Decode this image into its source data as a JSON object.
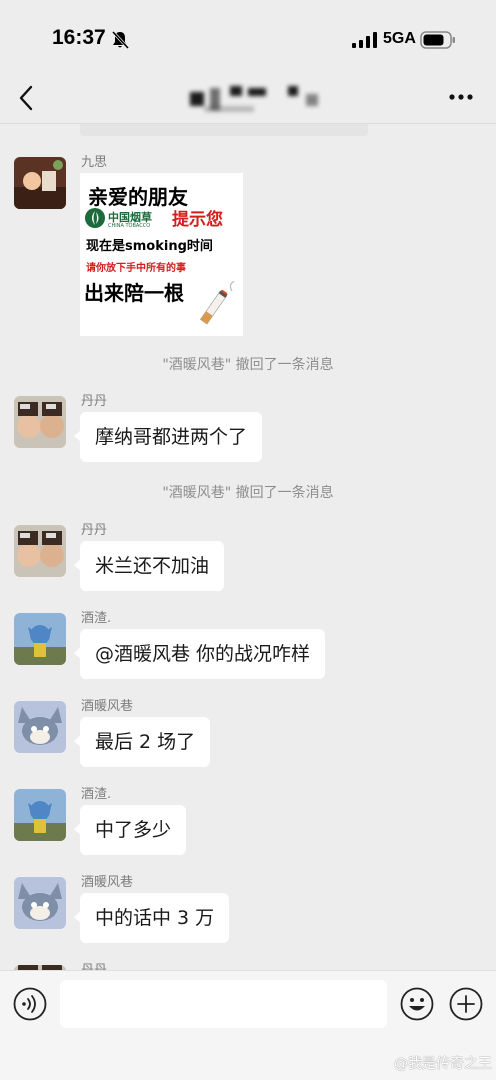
{
  "status_bar": {
    "time": "16:37",
    "network": "5GA"
  },
  "nav": {
    "back_icon": "chevron-left-icon",
    "more_icon": "more-dots-icon"
  },
  "messages": [
    {
      "sender": "九思",
      "type": "sticker"
    },
    {
      "sender": "丹丹",
      "text": "摩纳哥都进两个了"
    },
    {
      "sender": "丹丹",
      "text": "米兰还不加油"
    },
    {
      "sender": "酒渣.",
      "text": "@酒暖风巷 你的战况咋样"
    },
    {
      "sender": "酒暖风巷",
      "text": "最后 2 场了"
    },
    {
      "sender": "酒渣.",
      "text": "中了多少"
    },
    {
      "sender": "酒暖风巷",
      "text": "中的话中 3 万"
    },
    {
      "sender": "丹丹"
    }
  ],
  "system_notices": [
    "\"酒暖风巷\" 撤回了一条消息",
    "\"酒暖风巷\" 撤回了一条消息"
  ],
  "sticker": {
    "line1": "亲爱的朋友",
    "brand": "中国烟草",
    "brand_en": "CHINA TOBACCO",
    "hint": "提示您",
    "line3": "现在是smoking时间",
    "line4": "请你放下手中所有的事",
    "line5": "出来陪一根"
  },
  "input_bar": {
    "voice_icon": "voice-icon",
    "emoji_icon": "emoji-icon",
    "plus_icon": "plus-icon"
  },
  "watermark": "@我是传奇之王",
  "colors": {
    "background": "#ededed",
    "bubble": "#ffffff",
    "sticker_red": "#d41d1d",
    "tobacco_green": "#1d6b3c"
  }
}
